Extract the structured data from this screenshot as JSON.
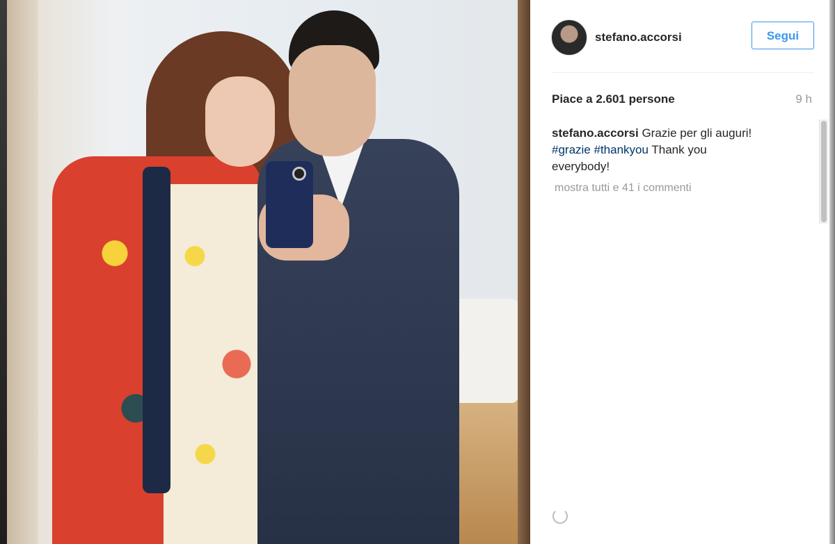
{
  "post": {
    "username": "stefano.accorsi",
    "follow_label": "Segui",
    "likes": "Piace a 2.601 persone",
    "time": "9 h",
    "caption": {
      "user": "stefano.accorsi",
      "text1": " Grazie per gli auguri!",
      "tags": [
        "#grazie",
        "#thankyou"
      ],
      "text2": " Thank you everybody!"
    },
    "show_all_comments": "mostra tutti e 41 i commenti"
  },
  "colors": {
    "accent": "#3897f0",
    "hashtag": "#003569",
    "text": "#262626",
    "muted": "#999999"
  },
  "icons": {
    "loading": "loading-spinner-icon"
  }
}
